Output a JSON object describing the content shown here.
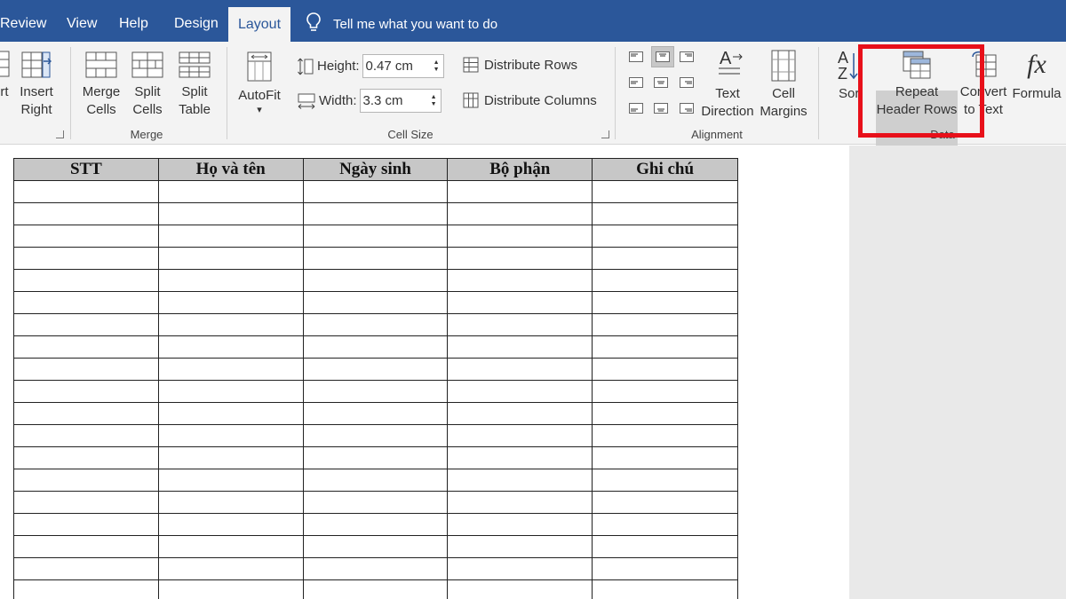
{
  "tabs": [
    {
      "label": "Review"
    },
    {
      "label": "View"
    },
    {
      "label": "Help"
    },
    {
      "label": "Design"
    },
    {
      "label": "Layout",
      "active": true
    }
  ],
  "tell_me": {
    "placeholder": "Tell me what you want to do",
    "icon": "lightbulb-icon"
  },
  "ribbon": {
    "insert_left_partial": "rt",
    "insert_right": {
      "line1": "Insert",
      "line2": "Right"
    },
    "merge_cells": {
      "line1": "Merge",
      "line2": "Cells"
    },
    "split_cells": {
      "line1": "Split",
      "line2": "Cells"
    },
    "split_table": {
      "line1": "Split",
      "line2": "Table"
    },
    "merge_group_label": "Merge",
    "autofit": {
      "label": "AutoFit",
      "caret": "▾"
    },
    "height": {
      "label": "Height:",
      "value": "0.47 cm"
    },
    "width": {
      "label": "Width:",
      "value": "3.3 cm"
    },
    "distribute_rows": "Distribute Rows",
    "distribute_columns": "Distribute Columns",
    "cell_size_group_label": "Cell Size",
    "text_direction": {
      "line1": "Text",
      "line2": "Direction"
    },
    "cell_margins": {
      "line1": "Cell",
      "line2": "Margins"
    },
    "alignment_group_label": "Alignment",
    "sort": {
      "line1": "Sor",
      "top_letters": "A Z"
    },
    "repeat_header_rows": {
      "line1": "Repeat",
      "line2": "Header Rows"
    },
    "convert_to_text": {
      "line1": "Convert",
      "line2": "to Text"
    },
    "formula": {
      "label": "Formula",
      "symbol": "fx"
    },
    "data_group_label": "Data"
  },
  "table": {
    "headers": [
      "STT",
      "Họ và tên",
      "Ngày sinh",
      "Bộ phận",
      "Ghi chú"
    ],
    "empty_row_count": 19
  },
  "colors": {
    "tab_bar": "#2b579a",
    "ribbon_bg": "#f3f3f3",
    "highlight": "#e8101a",
    "header_fill": "#c7c7c7"
  }
}
